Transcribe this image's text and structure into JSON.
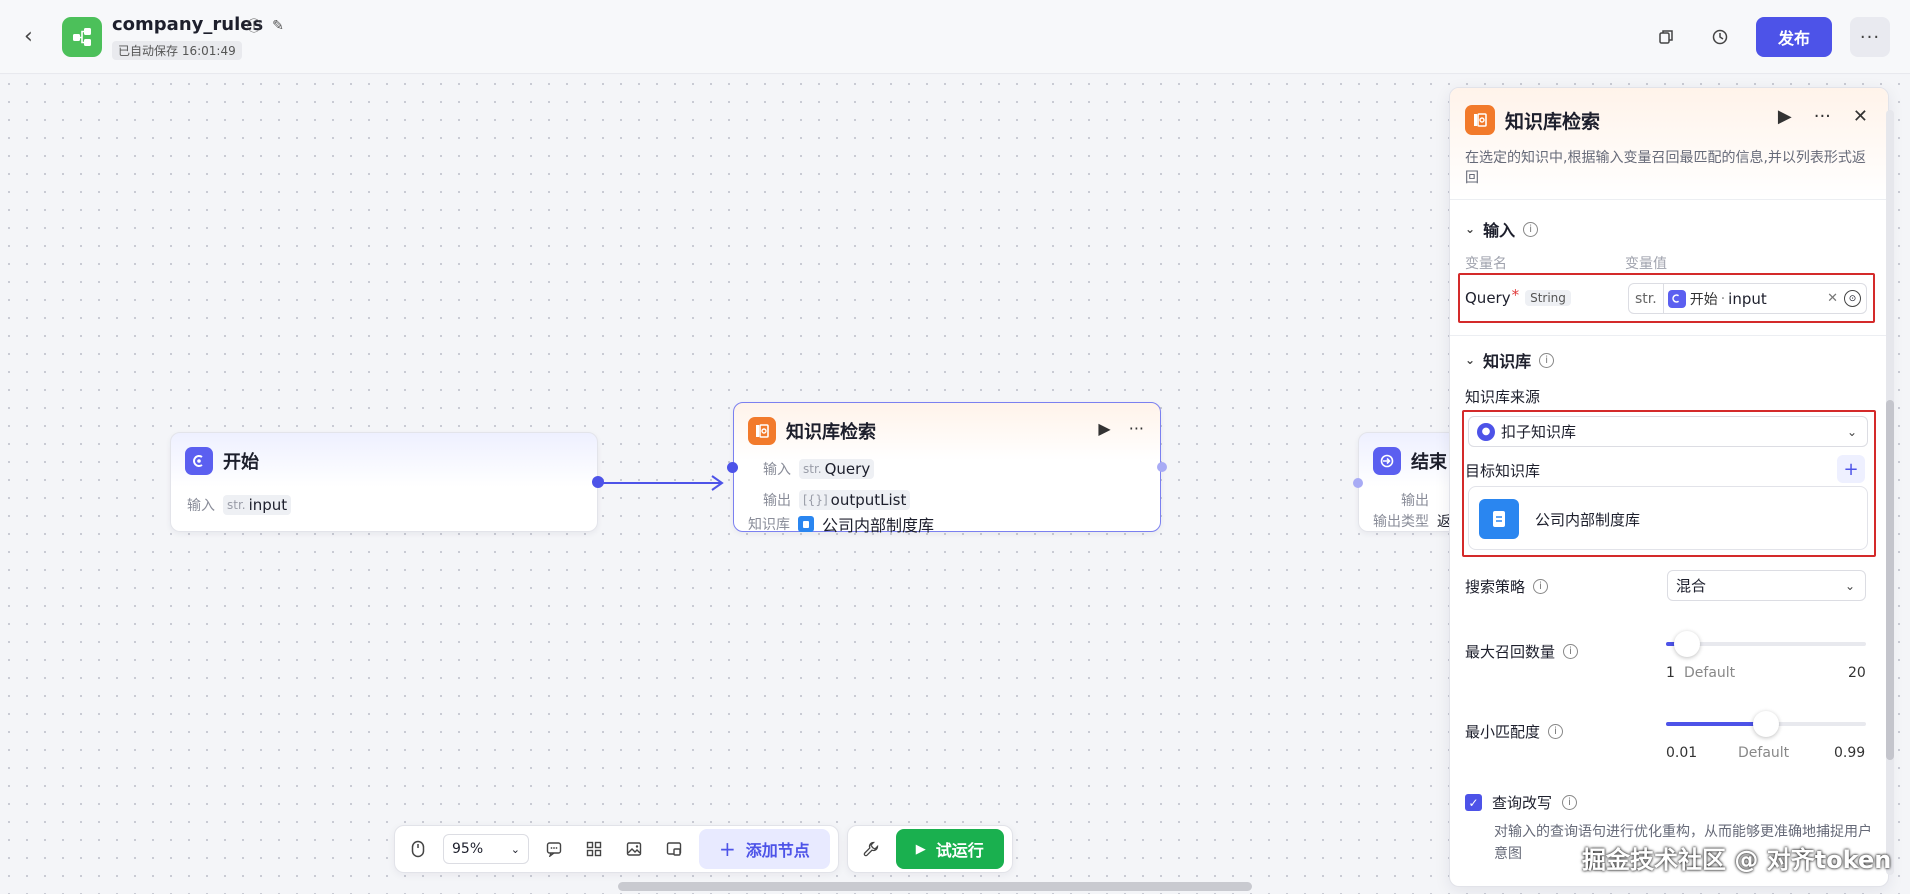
{
  "header": {
    "title": "company_rules",
    "autosave": "已自动保存 16:01:49",
    "publish_label": "发布",
    "more_label": "···"
  },
  "nodes": {
    "start": {
      "title": "开始",
      "input_label": "输入",
      "input_type": "str.",
      "input_value": "input"
    },
    "kb": {
      "title": "知识库检索",
      "input_label": "输入",
      "input_type": "str.",
      "input_value": "Query",
      "output_label": "输出",
      "output_type": "[{}]",
      "output_value": "outputList",
      "kb_label": "知识库",
      "kb_value": "公司内部制度库"
    },
    "end": {
      "title": "结束",
      "output_label": "输出",
      "output_type_label": "输出类型",
      "output_type_value": "返"
    }
  },
  "panel": {
    "title": "知识库检索",
    "description": "在选定的知识中,根据输入变量召回最匹配的信息,并以列表形式返回",
    "input_section": "输入",
    "col_name": "变量名",
    "col_value": "变量值",
    "query_name": "Query",
    "query_required": "*",
    "query_type": "String",
    "query_value_type": "str.",
    "query_value_source": "开始",
    "query_value_var": "input",
    "kb_section": "知识库",
    "kb_source_label": "知识库来源",
    "kb_source_value": "扣子知识库",
    "target_kb_label": "目标知识库",
    "target_kb_item": "公司内部制度库",
    "strategy_label": "搜索策略",
    "strategy_value": "混合",
    "max_recall_label": "最大召回数量",
    "max_recall": {
      "min": "1",
      "default": "Default",
      "max": "20",
      "value": 3
    },
    "min_match_label": "最小匹配度",
    "min_match": {
      "min": "0.01",
      "default": "Default",
      "max": "0.99",
      "value": 0.5
    },
    "rewrite_label": "查询改写",
    "rewrite_desc": "对输入的查询语句进行优化重构，从而能够更准确地捕捉用户意图"
  },
  "toolbar": {
    "zoom": "95%",
    "add_node": "添加节点",
    "run": "试运行"
  },
  "watermark": "掘金技术社区 @ 对齐token"
}
